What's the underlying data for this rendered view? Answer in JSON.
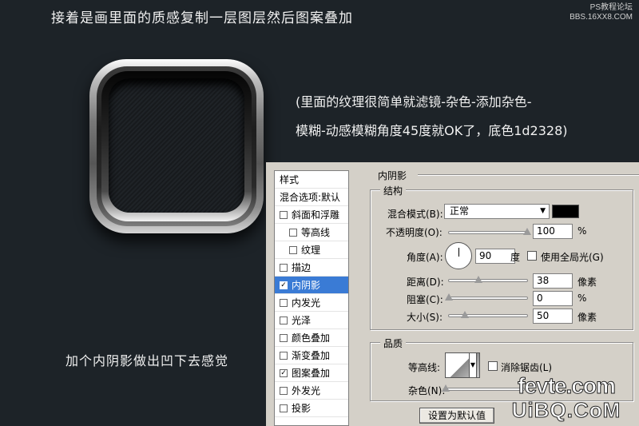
{
  "header": {
    "title": "接着是画里面的质感复制一层图层然后图案叠加"
  },
  "watermark": {
    "line1": "PS教程论坛",
    "line2": "BBS.16XX8.COM"
  },
  "description": {
    "line1": "(里面的纹理很简单就滤镜-杂色-添加杂色-",
    "line2": "模糊-动感模糊角度45度就OK了，底色1d2328)"
  },
  "note": "加个内阴影做出凹下去感觉",
  "colors": {
    "background": "#1d2328",
    "list_selected": "#3a7bd5",
    "dialog_bg": "#d4d0c8"
  },
  "styles_list": {
    "header": "样式",
    "blend_options": "混合选项:默认",
    "items": [
      {
        "label": "斜面和浮雕",
        "checked": false,
        "sub": false
      },
      {
        "label": "等高线",
        "checked": false,
        "sub": true
      },
      {
        "label": "纹理",
        "checked": false,
        "sub": true
      },
      {
        "label": "描边",
        "checked": false,
        "sub": false
      },
      {
        "label": "内阴影",
        "checked": true,
        "sub": false,
        "active": true
      },
      {
        "label": "内发光",
        "checked": false,
        "sub": false
      },
      {
        "label": "光泽",
        "checked": false,
        "sub": false
      },
      {
        "label": "颜色叠加",
        "checked": false,
        "sub": false
      },
      {
        "label": "渐变叠加",
        "checked": false,
        "sub": false
      },
      {
        "label": "图案叠加",
        "checked": true,
        "sub": false
      },
      {
        "label": "外发光",
        "checked": false,
        "sub": false
      },
      {
        "label": "投影",
        "checked": false,
        "sub": false
      }
    ]
  },
  "inner_shadow": {
    "title": "内阴影",
    "structure": {
      "title": "结构",
      "blend_mode_label": "混合模式(B):",
      "blend_mode_value": "正常",
      "opacity_label": "不透明度(O):",
      "opacity_value": "100",
      "opacity_unit": "%",
      "opacity_level": 1.0,
      "angle_label": "角度(A):",
      "angle_value": "90",
      "angle_unit": "度",
      "global_light_label": "使用全局光(G)",
      "global_light_checked": false,
      "distance_label": "距离(D):",
      "distance_value": "38",
      "distance_unit": "像素",
      "distance_level": 0.38,
      "choke_label": "阻塞(C):",
      "choke_value": "0",
      "choke_unit": "%",
      "choke_level": 0,
      "size_label": "大小(S):",
      "size_value": "50",
      "size_unit": "像素",
      "size_level": 0.2
    },
    "quality": {
      "title": "品质",
      "contour_label": "等高线:",
      "antialias_label": "消除锯齿(L)",
      "antialias_checked": false,
      "noise_label": "杂色(N):",
      "noise_level": 0
    },
    "buttons": {
      "set_default": "设置为默认值"
    }
  },
  "site_logo": {
    "top": "fevte.com",
    "bottom": "UiBQ.CoM"
  }
}
